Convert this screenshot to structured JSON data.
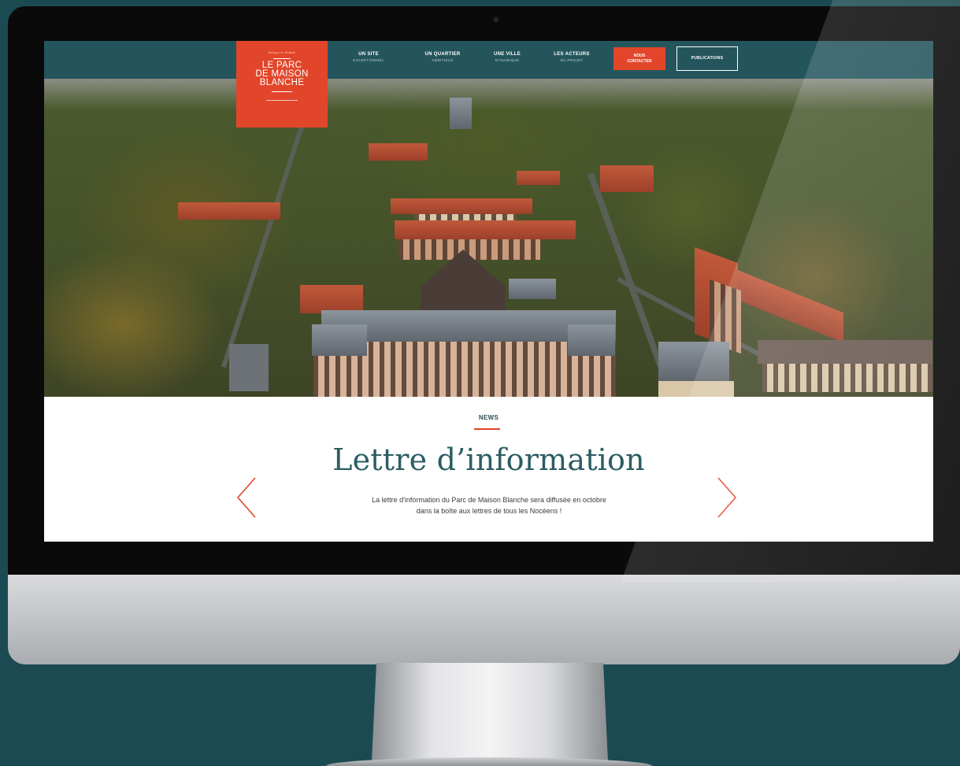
{
  "logo": {
    "tagline": "Noisy-le-Grand",
    "title_line1": "LE PARC",
    "title_line2": "DE MAISON",
    "title_line3": "BLANCHE"
  },
  "nav": {
    "items": [
      {
        "main": "UN SITE",
        "sub": "EXCEPTIONNEL"
      },
      {
        "main": "UN QUARTIER",
        "sub": "AMBITIEUX"
      },
      {
        "main": "UNE VILLE",
        "sub": "DYNAMIQUE"
      },
      {
        "main": "LES ACTEURS",
        "sub": "DU PROJET"
      }
    ],
    "contact_line1": "NOUS",
    "contact_line2": "CONTACTER",
    "publications": "PUBLICATIONS"
  },
  "news": {
    "label": "NEWS",
    "title": "Lettre d’information",
    "text_line1": "La lettre d'information du Parc de Maison Blanche sera diffusée en octobre",
    "text_line2": "dans la boîte aux lettres de tous les Nocéens !"
  },
  "icons": {
    "prev": "chevron-left-icon",
    "next": "chevron-right-icon"
  },
  "colors": {
    "background": "#1c4a52",
    "nav_bar": "#24555d",
    "accent": "#e2462a",
    "title": "#2b5d63"
  }
}
